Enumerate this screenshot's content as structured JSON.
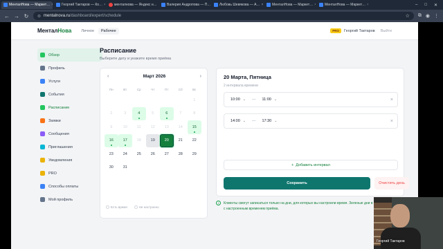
{
  "browser": {
    "tabs": [
      {
        "label": "МенталНова — Маркет…",
        "active": true,
        "favicon": "site-icon"
      },
      {
        "label": "Георгий Тактаров — Ко…",
        "active": false,
        "favicon": "site-icon"
      },
      {
        "label": "менталнова — Яндекс н…",
        "active": false,
        "favicon": "yandex-icon"
      },
      {
        "label": "Валерия Андропова — П…",
        "active": false,
        "favicon": "site-icon"
      },
      {
        "label": "Любовь Шевякова — А…",
        "active": false,
        "favicon": "site-icon"
      },
      {
        "label": "МенталНова — Маркет…",
        "active": false,
        "favicon": "site-icon"
      },
      {
        "label": "МенталНова — Маркет…",
        "active": false,
        "favicon": "site-icon"
      }
    ],
    "url_host": "mentalnova.ru",
    "url_path": "/dashboard/expert/schedule"
  },
  "header": {
    "logo_part1": "Ментал",
    "logo_part2": "Нова",
    "modes": [
      "Личное",
      "Рабочее"
    ],
    "user_badge": "PRO",
    "user_name": "Георгий Тактаров",
    "logout": "Выйти"
  },
  "sidebar": {
    "items": [
      {
        "label": "Обзор",
        "icon": "grid-icon",
        "active": true
      },
      {
        "label": "Профиль",
        "icon": "user-icon"
      },
      {
        "label": "Услуги",
        "icon": "briefcase-icon"
      },
      {
        "label": "События",
        "icon": "calendar-icon"
      },
      {
        "label": "Расписание",
        "icon": "clock-icon",
        "active": true
      },
      {
        "label": "Заявки",
        "icon": "inbox-icon"
      },
      {
        "label": "Сообщения",
        "icon": "message-icon"
      },
      {
        "label": "Приглашения",
        "icon": "invite-icon"
      },
      {
        "label": "Уведомления",
        "icon": "bell-icon"
      },
      {
        "label": "PRO",
        "icon": "star-icon"
      },
      {
        "label": "Способы оплаты",
        "icon": "card-icon"
      },
      {
        "label": "Мой профиль",
        "icon": "profile-link-icon"
      }
    ]
  },
  "main": {
    "title": "Расписание",
    "subtitle": "Выберите дату и укажите время приёма"
  },
  "calendar": {
    "month": "Март 2026",
    "weekdays": [
      "Пн",
      "Вт",
      "Ср",
      "Чт",
      "Пт",
      "Сб",
      "Вс"
    ],
    "days": [
      {
        "d": "",
        "s": "blank"
      },
      {
        "d": "",
        "s": "blank"
      },
      {
        "d": "",
        "s": "blank"
      },
      {
        "d": "",
        "s": "blank"
      },
      {
        "d": "",
        "s": "blank"
      },
      {
        "d": "",
        "s": "blank"
      },
      {
        "d": "1",
        "s": "dim"
      },
      {
        "d": "2",
        "s": "dim"
      },
      {
        "d": "3",
        "s": "dim"
      },
      {
        "d": "4",
        "s": "avail"
      },
      {
        "d": "5",
        "s": "dim"
      },
      {
        "d": "6",
        "s": "avail"
      },
      {
        "d": "7",
        "s": "dim"
      },
      {
        "d": "8",
        "s": "dim"
      },
      {
        "d": "9",
        "s": "dim"
      },
      {
        "d": "10",
        "s": "dim"
      },
      {
        "d": "11",
        "s": "dim"
      },
      {
        "d": "12",
        "s": "dim"
      },
      {
        "d": "13",
        "s": "dim"
      },
      {
        "d": "14",
        "s": "dim"
      },
      {
        "d": "15",
        "s": "avail"
      },
      {
        "d": "16",
        "s": "avail"
      },
      {
        "d": "17",
        "s": "avail"
      },
      {
        "d": "18",
        "s": "dim"
      },
      {
        "d": "19",
        "s": "today"
      },
      {
        "d": "20",
        "s": "sel"
      },
      {
        "d": "21",
        "s": "normal"
      },
      {
        "d": "22",
        "s": "normal"
      },
      {
        "d": "23",
        "s": "normal"
      },
      {
        "d": "24",
        "s": "normal"
      },
      {
        "d": "25",
        "s": "normal"
      },
      {
        "d": "26",
        "s": "normal"
      },
      {
        "d": "27",
        "s": "normal"
      },
      {
        "d": "28",
        "s": "normal"
      },
      {
        "d": "29",
        "s": "normal"
      },
      {
        "d": "30",
        "s": "normal"
      },
      {
        "d": "31",
        "s": "normal"
      }
    ],
    "legend_has_time": "Есть время",
    "legend_not_set": "Не настроено"
  },
  "day_panel": {
    "title": "20 Марта, Пятница",
    "subtitle": "2 интервала времени",
    "slots": [
      {
        "from": "10:00",
        "to": "11:00"
      },
      {
        "from": "14:00",
        "to": "17:30"
      }
    ],
    "add_label": "Добавить интервал",
    "save_label": "Сохранить",
    "clear_label": "Очистить день"
  },
  "info_text": "Клиенты смогут записаться только на дни, для которых вы настроили время. Зеленые дни в календаре — дни с настроенным временем приёма.",
  "webcam": {
    "name": "Георгий Тактаров"
  }
}
